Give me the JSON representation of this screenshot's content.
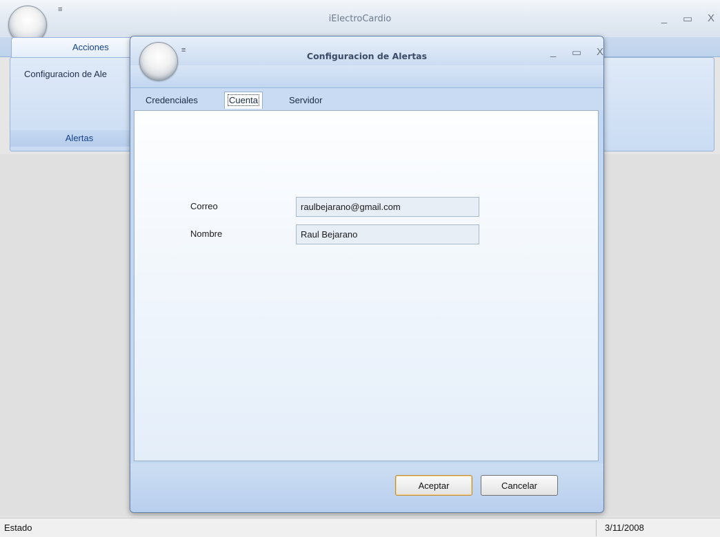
{
  "app": {
    "title": "iElectroCardio",
    "caption_buttons": {
      "minimize": "_",
      "maximize": "▭",
      "close": "X"
    },
    "qat_glyph": "≡",
    "ribbon": {
      "tab_label": "Acciones",
      "group": {
        "item_label": "Configuracion de Ale",
        "label": "Alertas"
      }
    },
    "status": {
      "left": "Estado",
      "right": "3/11/2008"
    }
  },
  "dialog": {
    "title": "Configuracion de Alertas",
    "caption_buttons": {
      "minimize": "_",
      "maximize": "▭",
      "close": "X"
    },
    "tabs": [
      {
        "label": "Credenciales",
        "active": false
      },
      {
        "label": "Cuenta",
        "active": true
      },
      {
        "label": "Servidor",
        "active": false
      }
    ],
    "fields": {
      "correo": {
        "label": "Correo",
        "value": "raulbejarano@gmail.com"
      },
      "nombre": {
        "label": "Nombre",
        "value": "Raul Bejarano"
      }
    },
    "buttons": {
      "accept": "Aceptar",
      "cancel": "Cancelar"
    }
  }
}
